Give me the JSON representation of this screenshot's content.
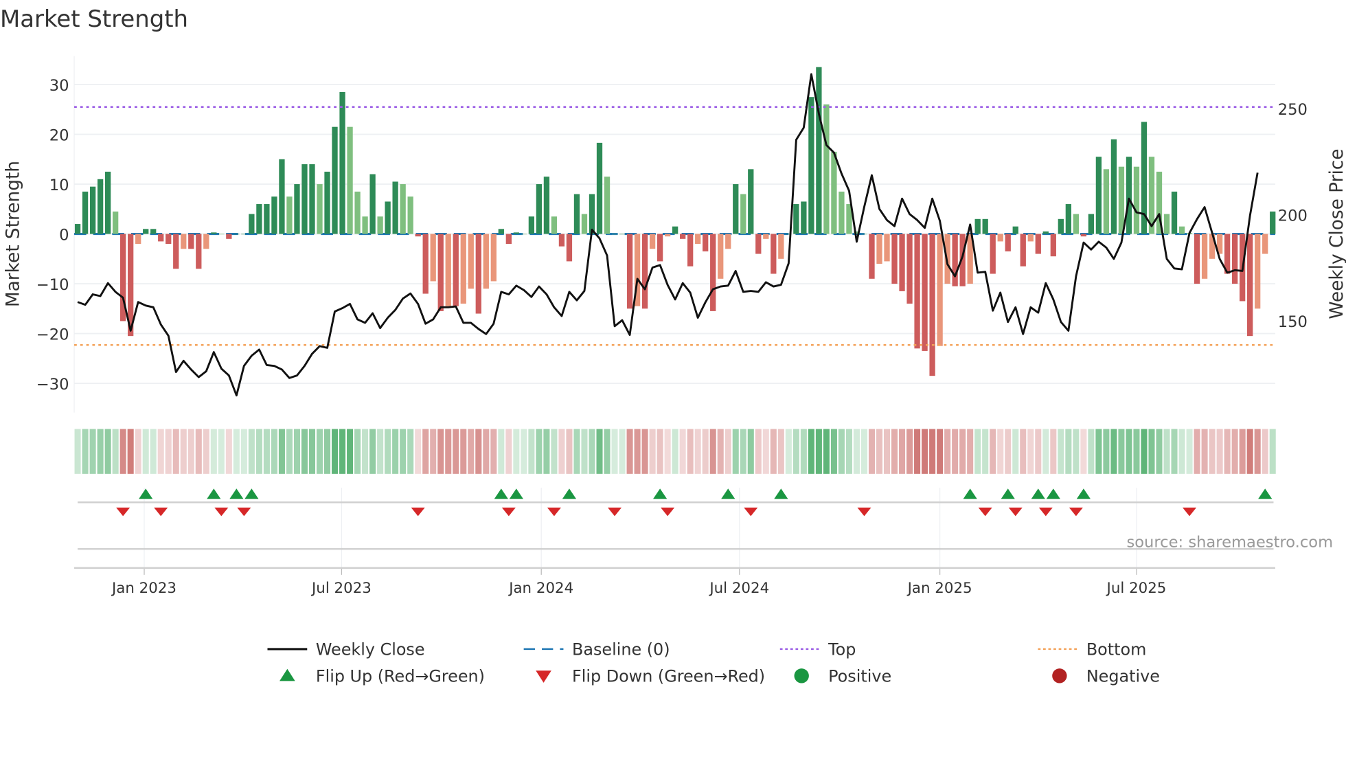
{
  "chart_data": {
    "type": "bar",
    "title": "Market Strength",
    "ylabel": "Market Strength",
    "y2label": "Weekly Close Price",
    "ylim": [
      -36,
      36
    ],
    "y2lim": [
      105,
      280
    ],
    "yticks": [
      30,
      20,
      10,
      0,
      -10,
      -20,
      -30
    ],
    "y2ticks": [
      250,
      200,
      150
    ],
    "xtick_labels": [
      {
        "label": "Jan 2023",
        "week": 8.8
      },
      {
        "label": "Jul 2023",
        "week": 34.9
      },
      {
        "label": "Jan 2024",
        "week": 61.3
      },
      {
        "label": "Jul 2024",
        "week": 87.5
      },
      {
        "label": "Jan 2025",
        "week": 114.0
      },
      {
        "label": "Jul 2025",
        "week": 140.0
      }
    ],
    "top_level": 25.5,
    "bottom_level": -22.3,
    "baseline": 0,
    "strength": [
      2,
      8.5,
      9.5,
      11,
      12.5,
      4.5,
      -17.5,
      -20.5,
      -2,
      1,
      1,
      -1.5,
      -2,
      -7,
      -3,
      -3,
      -7,
      -3,
      0.3,
      0,
      -1,
      0,
      0,
      4,
      6,
      6,
      7.5,
      15,
      7.5,
      10,
      14,
      14,
      10,
      12.5,
      21.5,
      28.5,
      21.5,
      8.5,
      3.5,
      12,
      3.5,
      6.5,
      10.5,
      10,
      7.5,
      -0.5,
      -12,
      -9.5,
      -15.5,
      -14.5,
      -14.5,
      -14,
      -11,
      -16,
      -11,
      -9.5,
      1,
      -2,
      0.3,
      0,
      3.5,
      10,
      11.5,
      3.5,
      -2.5,
      -5.5,
      8,
      4,
      8,
      18.3,
      11.5,
      0,
      0,
      -15,
      -14.5,
      -15,
      -3,
      -5.5,
      -0.5,
      1.5,
      -1,
      -6.5,
      -2,
      -3.5,
      -15.5,
      -9,
      -3,
      10,
      8,
      13,
      -4,
      -1,
      -8,
      -5,
      0,
      6,
      6.5,
      27.5,
      33.5,
      26,
      16.5,
      8.5,
      6,
      0.5,
      0,
      -9,
      -6,
      -5.5,
      -10,
      -11.5,
      -14,
      -23,
      -23.5,
      -28.5,
      -22.5,
      -10,
      -10.5,
      -10.5,
      -10,
      3,
      3,
      -8,
      -1.5,
      -3.5,
      1.5,
      -6.5,
      -1.5,
      -4,
      0.5,
      -4.5,
      3,
      6,
      4,
      -0.5,
      4,
      15.5,
      13,
      19,
      13.5,
      15.5,
      13.5,
      22.5,
      15.5,
      12.5,
      4,
      8.5,
      1.5,
      0.2,
      -10,
      -9,
      -5,
      -4,
      -8,
      -10,
      -13.5,
      -20.5,
      -15,
      -4,
      4.5
    ],
    "weekly_close": [
      159,
      157.7,
      162.6,
      161.8,
      167.9,
      163.8,
      161,
      145.5,
      159,
      157.3,
      156.5,
      148.4,
      143.1,
      126,
      131.3,
      127.2,
      123.6,
      126.4,
      135.4,
      127.6,
      124.4,
      115,
      128.9,
      133.7,
      136.6,
      129.3,
      128.9,
      127.2,
      123.2,
      124.4,
      128.9,
      134.6,
      138.2,
      137.4,
      154.5,
      156.1,
      158.1,
      150.8,
      149.2,
      153.7,
      146.7,
      151.6,
      155.3,
      160.6,
      163,
      158.1,
      148.8,
      150.8,
      156.5,
      156.5,
      156.9,
      149.2,
      149.2,
      146.3,
      143.9,
      148.8,
      163.8,
      162.6,
      166.7,
      164.6,
      161.4,
      166.3,
      162.6,
      156.5,
      152.4,
      163.8,
      159.8,
      164.2,
      193.1,
      189,
      180.9,
      147.6,
      150.4,
      143.5,
      169.9,
      165,
      175.2,
      176.4,
      167.1,
      160.2,
      167.9,
      163.4,
      151.6,
      158.9,
      165,
      166.3,
      166.7,
      173.6,
      163.8,
      164.2,
      163.8,
      168.3,
      166.3,
      167.1,
      177.2,
      235.4,
      241.1,
      266.3,
      247.6,
      232.9,
      229.3,
      219.5,
      211.4,
      187.4,
      203.7,
      218.7,
      202.8,
      197.6,
      194.7,
      207.7,
      200.4,
      197.6,
      193.9,
      207.7,
      197.2,
      176.8,
      171.1,
      180.5,
      195.5,
      172.8,
      173.2,
      154.9,
      163.4,
      149.6,
      156.5,
      143.9,
      156.5,
      154,
      167.9,
      160.2,
      149.6,
      145.5,
      171.1,
      187,
      183.7,
      187.4,
      184.6,
      179.3,
      187,
      207.7,
      201.2,
      200.4,
      194.7,
      200.4,
      179.3,
      174.8,
      174.4,
      191.5,
      198,
      203.7,
      191.5,
      179.3,
      172.8,
      174,
      173.6,
      199.6,
      219.9
    ],
    "flip_up_weeks": [
      9,
      18,
      21,
      23,
      56,
      58,
      65,
      77,
      86,
      93,
      118,
      123,
      127,
      129,
      133,
      157
    ],
    "flip_down_weeks": [
      6,
      11,
      19,
      22,
      45,
      57,
      63,
      71,
      78,
      89,
      104,
      120,
      124,
      128,
      132,
      147
    ],
    "legend": [
      {
        "key": "weekly_close",
        "label": "Weekly Close",
        "icon": "line",
        "color": "#111111"
      },
      {
        "key": "baseline",
        "label": "Baseline (0)",
        "icon": "dash",
        "color": "#1f77b4"
      },
      {
        "key": "top",
        "label": "Top",
        "icon": "dot-purple",
        "color": "#9b5de5"
      },
      {
        "key": "bottom",
        "label": "Bottom",
        "icon": "dot-orange",
        "color": "#f4a259"
      },
      {
        "key": "flip_up",
        "label": "Flip Up (Red→Green)",
        "icon": "triangle-up",
        "color": "#1a9641"
      },
      {
        "key": "flip_down",
        "label": "Flip Down (Green→Red)",
        "icon": "triangle-down",
        "color": "#d62728"
      },
      {
        "key": "positive",
        "label": "Positive",
        "icon": "circle",
        "color": "#1a9641"
      },
      {
        "key": "negative",
        "label": "Negative",
        "icon": "circle",
        "color": "#b22222"
      }
    ],
    "legend_position": "bottom",
    "source": "source: sharemaestro.com",
    "colors": {
      "pos_rising": "#2e8b57",
      "pos_falling": "#7fbf7f",
      "neg_falling": "#cd5c5c",
      "neg_rising": "#e9967a",
      "top": "#9b5de5",
      "bottom": "#f4a259",
      "baseline": "#1f77b4",
      "up": "#1a9641",
      "down": "#d62728"
    }
  }
}
